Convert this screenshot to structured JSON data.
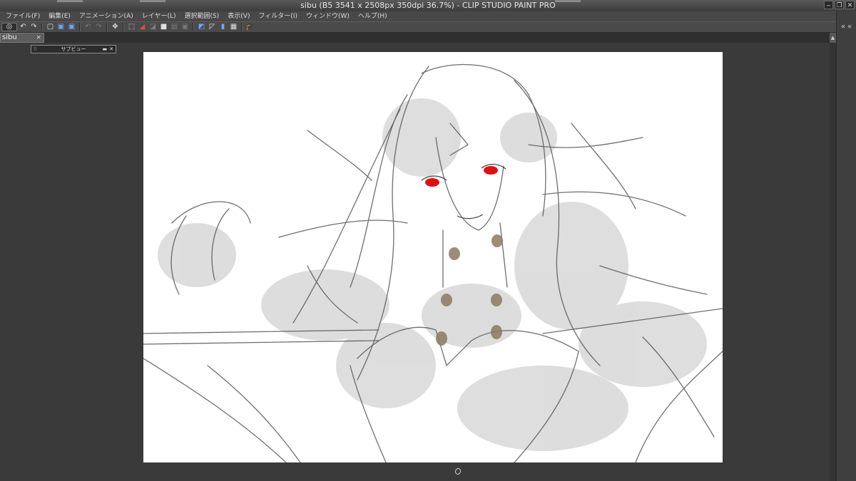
{
  "window": {
    "title": "sibu (B5 3541 x 2508px 350dpi 36.7%)  - CLIP STUDIO PAINT PRO",
    "controls": [
      "minimize-icon",
      "restore-icon",
      "close-icon"
    ]
  },
  "menu": {
    "items": [
      "ファイル(F)",
      "編集(E)",
      "アニメーション(A)",
      "レイヤー(L)",
      "選択範囲(S)",
      "表示(V)",
      "フィルター(I)",
      "ウィンドウ(W)",
      "ヘルプ(H)"
    ]
  },
  "toolbar": {
    "icons": [
      "clip-studio-logo-icon",
      "undo-icon",
      "redo-icon",
      "new-file-icon",
      "zoom-icon",
      "zoom-fit-icon",
      "undo-disabled-icon",
      "redo-disabled-icon",
      "transform-icon",
      "selection-icon",
      "clear-icon",
      "fill-icon",
      "cut-icon",
      "copy-icon",
      "paste-icon",
      "ruler-icon",
      "snap-icon",
      "pen-icon",
      "grid-icon",
      "academy-icon"
    ]
  },
  "tab": {
    "label": "sibu",
    "close": "×"
  },
  "subview": {
    "title": "サブビュー",
    "controls": [
      "minimize-icon",
      "close-icon"
    ]
  },
  "artwork": {
    "description_colors": {
      "eyes": "#e11010",
      "buttons": "#8a7a60",
      "line": "#555555",
      "shade": "#d8d8d8"
    }
  }
}
